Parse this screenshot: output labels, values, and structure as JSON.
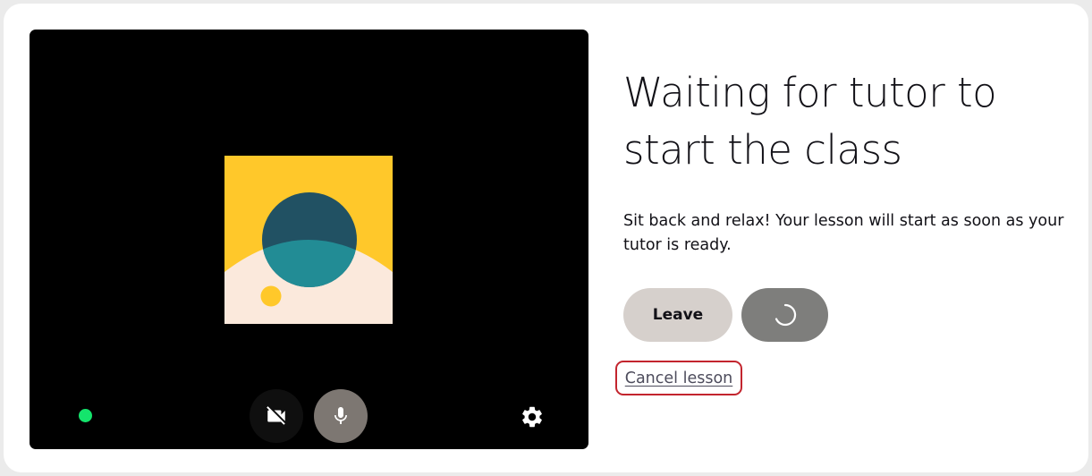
{
  "heading": "Waiting for tutor to start the class",
  "description": "Sit back and relax! Your lesson will start as soon as your tutor is ready.",
  "buttons": {
    "leave_label": "Leave",
    "cancel_label": "Cancel lesson"
  },
  "video": {
    "connection_status": "connected",
    "camera": "off",
    "microphone": "on"
  },
  "icons": {
    "camera": "video-off-icon",
    "microphone": "microphone-icon",
    "settings": "gear-icon",
    "loading": "spinner-icon"
  },
  "colors": {
    "status_dot": "#14e46c",
    "avatar_background": "#ffc82a",
    "avatar_circle": "#215163",
    "avatar_circle_overlap": "#228c95",
    "avatar_ground": "#fbe9dc",
    "leave_button": "#d6d0cc",
    "loading_button": "#7e7e7c",
    "cancel_outline": "#c3252e"
  }
}
